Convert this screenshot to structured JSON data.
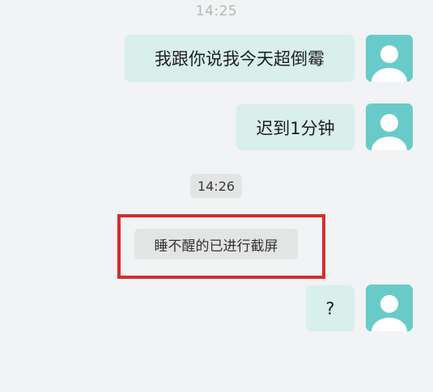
{
  "chat": {
    "time_top": "14:25",
    "messages": [
      {
        "text": "我跟你说我今天超倒霉"
      },
      {
        "text": "迟到1分钟"
      },
      {
        "text": "?"
      }
    ],
    "time_mid": "14:26",
    "system_notice": "睡不醒的已进行截屏"
  },
  "icons": {
    "avatar": "default-user-avatar-icon"
  },
  "colors": {
    "background": "#f1f3f4",
    "bubble": "#d8efec",
    "avatar": "#69cbc9",
    "highlight": "#d62c2c"
  }
}
